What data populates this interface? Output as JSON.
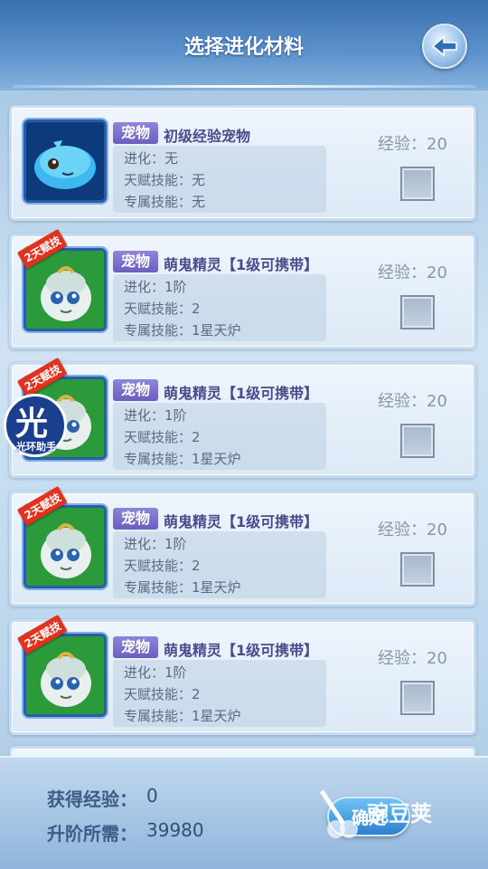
{
  "header": {
    "title": "选择进化材料"
  },
  "labels": {
    "pet_tag": "宠物",
    "evolution_prefix": "进化：",
    "talent_prefix": "天赋技能：",
    "exclusive_prefix": "专属技能：",
    "exp_prefix": "经验："
  },
  "items": [
    {
      "name": "初级经验宠物",
      "evolution": "无",
      "talent": "无",
      "exclusive": "无",
      "exp": "20",
      "badge": ""
    },
    {
      "name": "萌鬼精灵【1级可携带】",
      "evolution": "1阶",
      "talent": "2",
      "exclusive": "1星天炉",
      "exp": "20",
      "badge": "2天赋技"
    },
    {
      "name": "萌鬼精灵【1级可携带】",
      "evolution": "1阶",
      "talent": "2",
      "exclusive": "1星天炉",
      "exp": "20",
      "badge": "2天赋技"
    },
    {
      "name": "萌鬼精灵【1级可携带】",
      "evolution": "1阶",
      "talent": "2",
      "exclusive": "1星天炉",
      "exp": "20",
      "badge": "2天赋技"
    },
    {
      "name": "萌鬼精灵【1级可携带】",
      "evolution": "1阶",
      "talent": "2",
      "exclusive": "1星天炉",
      "exp": "20",
      "badge": "2天赋技"
    }
  ],
  "footer": {
    "gain_label": "获得经验：",
    "gain_value": "0",
    "need_label": "升阶所需：",
    "need_value": "39980",
    "confirm_label": "确定"
  },
  "watermarks": {
    "left_glyph": "光",
    "left_text": "光环助手",
    "right_text": "豌豆荚"
  },
  "colors": {
    "header_blue": "#3a6fb0",
    "pet_tag_purple": "#6a5fc0",
    "badge_red": "#e2321e",
    "confirm_blue": "#2d7fd0"
  }
}
